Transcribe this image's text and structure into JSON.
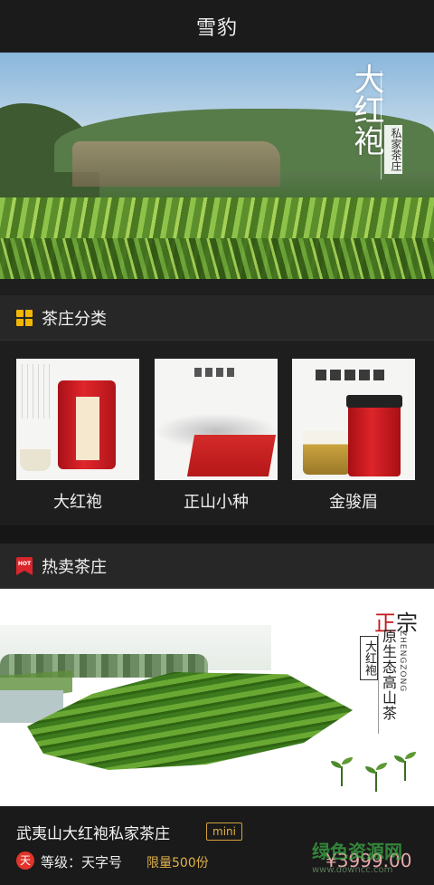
{
  "header": {
    "title": "雪豹"
  },
  "hero": {
    "brand": "大红袍",
    "subtitle": "私家茶庄"
  },
  "categories_section": {
    "title": "茶庄分类",
    "items": [
      {
        "label": "大红袍"
      },
      {
        "label": "正山小种"
      },
      {
        "label": "金骏眉"
      }
    ]
  },
  "hot_section": {
    "title": "热卖茶庄",
    "icon_text": "HOT"
  },
  "banner": {
    "zheng": "正",
    "zong": "宗",
    "tagline": "原生态高山茶",
    "pinyin": "ZHENGZONG",
    "boxed": "大红袍"
  },
  "product": {
    "name": "武夷山大红袍私家茶庄",
    "badge": "mini",
    "level_icon": "天",
    "level_text": "等级：天字号",
    "limit_text": "限量500份",
    "price": "¥3999.00"
  },
  "watermark": {
    "line1": "绿色资源网",
    "line2": "www.downcc.com"
  },
  "colors": {
    "accent_yellow": "#f2b705",
    "hot_red": "#d9262c",
    "gold": "#e0b04a"
  }
}
